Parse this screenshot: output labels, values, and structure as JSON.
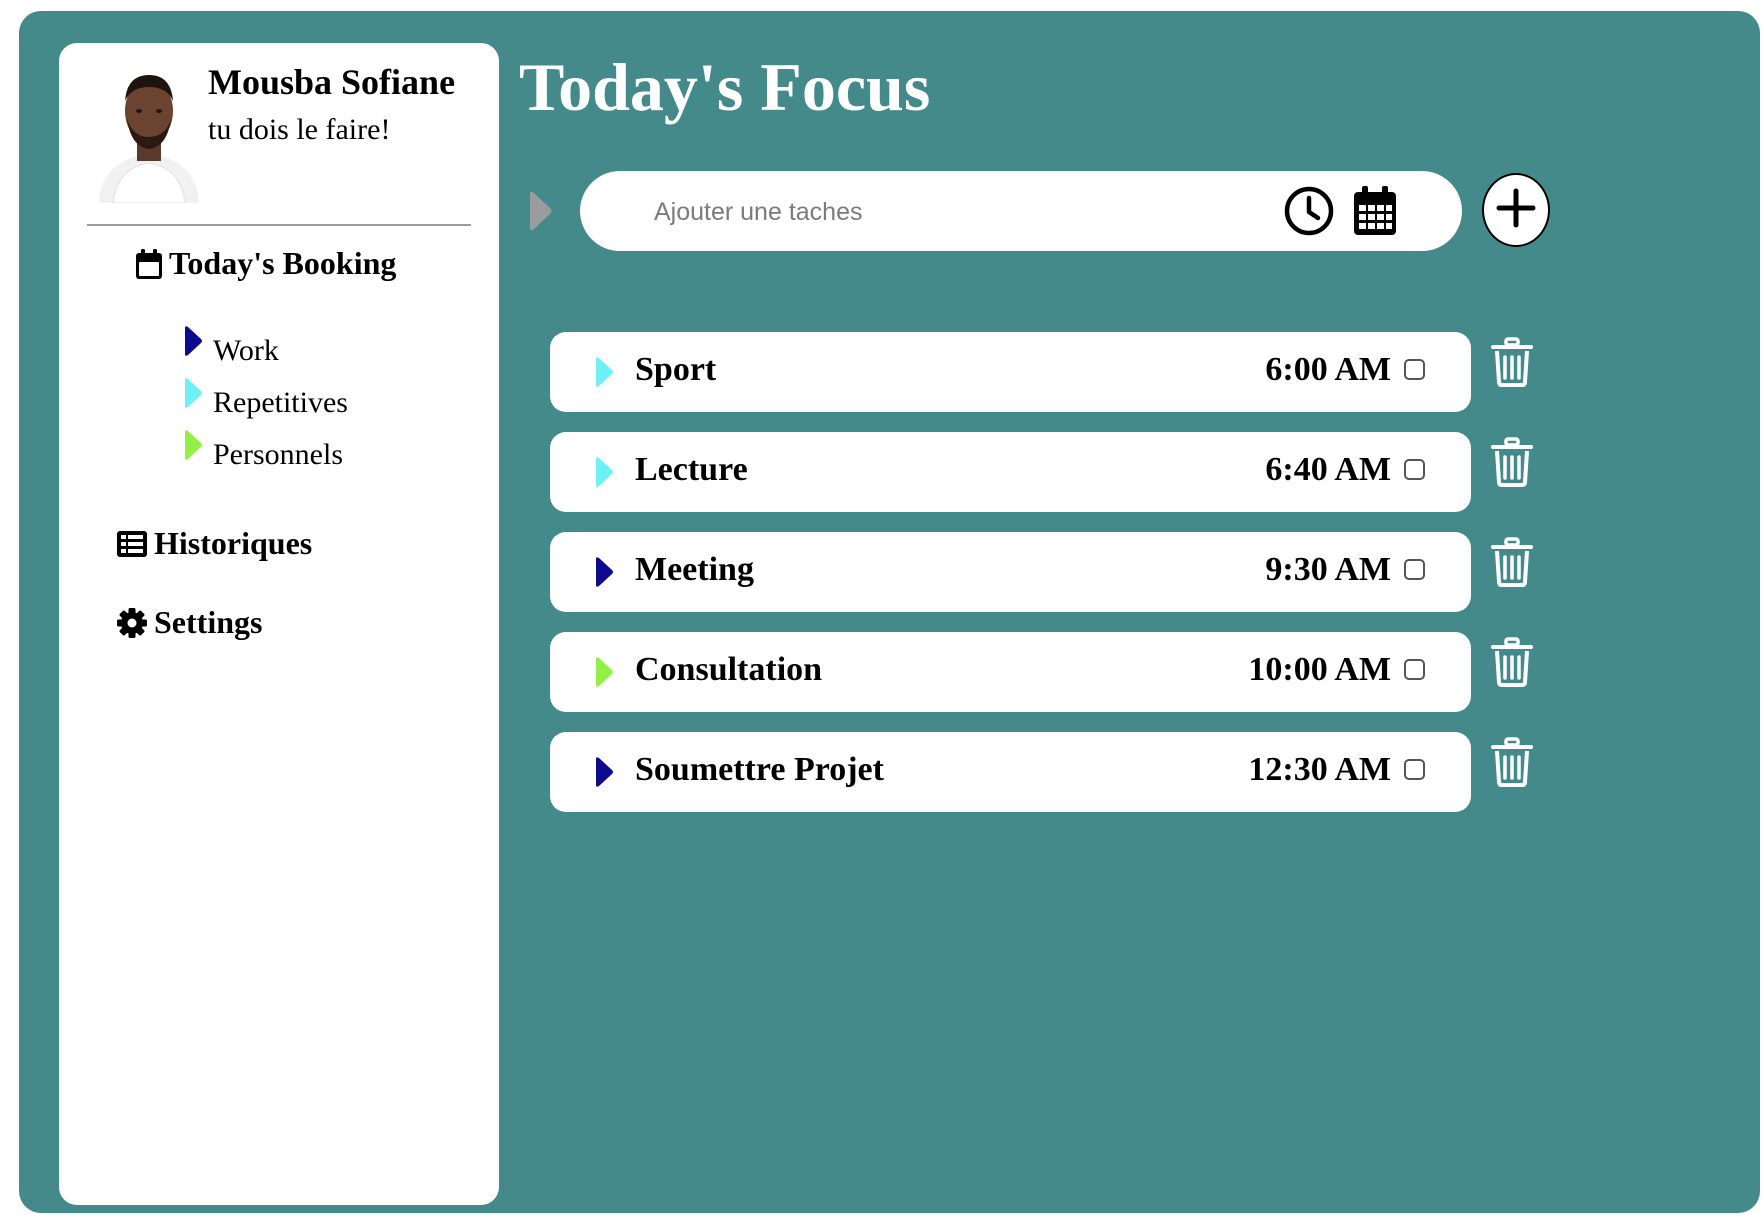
{
  "user": {
    "name": "Mousba Sofiane",
    "motto": "tu dois le faire!",
    "avatar_icon": "user-avatar-photo"
  },
  "sidebar": {
    "booking": {
      "label": "Today's Booking",
      "icon": "calendar-icon"
    },
    "categories": [
      {
        "label": "Work",
        "color": "#0b0b8c",
        "icon": "play-triangle-icon"
      },
      {
        "label": "Repetitives",
        "color": "#6ff0f7",
        "icon": "play-triangle-icon"
      },
      {
        "label": "Personnels",
        "color": "#92f047",
        "icon": "play-triangle-icon"
      }
    ],
    "history": {
      "label": "Historiques",
      "icon": "table-list-icon"
    },
    "settings": {
      "label": "Settings",
      "icon": "gear-icon"
    }
  },
  "main": {
    "title": "Today's Focus",
    "add_task": {
      "placeholder": "Ajouter une taches",
      "value": "",
      "category_color": "#9b9b9b"
    },
    "tasks": [
      {
        "name": "Sport",
        "time": "6:00 AM",
        "color": "#6ff0f7",
        "done": false
      },
      {
        "name": "Lecture",
        "time": "6:40 AM",
        "color": "#6ff0f7",
        "done": false
      },
      {
        "name": "Meeting",
        "time": "9:30 AM",
        "color": "#0b0b8c",
        "done": false
      },
      {
        "name": "Consultation",
        "time": "10:00 AM",
        "color": "#92f047",
        "done": false
      },
      {
        "name": "Soumettre Projet",
        "time": "12:30 AM",
        "color": "#0b0b8c",
        "done": false
      }
    ]
  },
  "colors": {
    "background": "#458a8b",
    "panel": "#ffffff",
    "work": "#0b0b8c",
    "repetitive": "#6ff0f7",
    "personal": "#92f047"
  }
}
